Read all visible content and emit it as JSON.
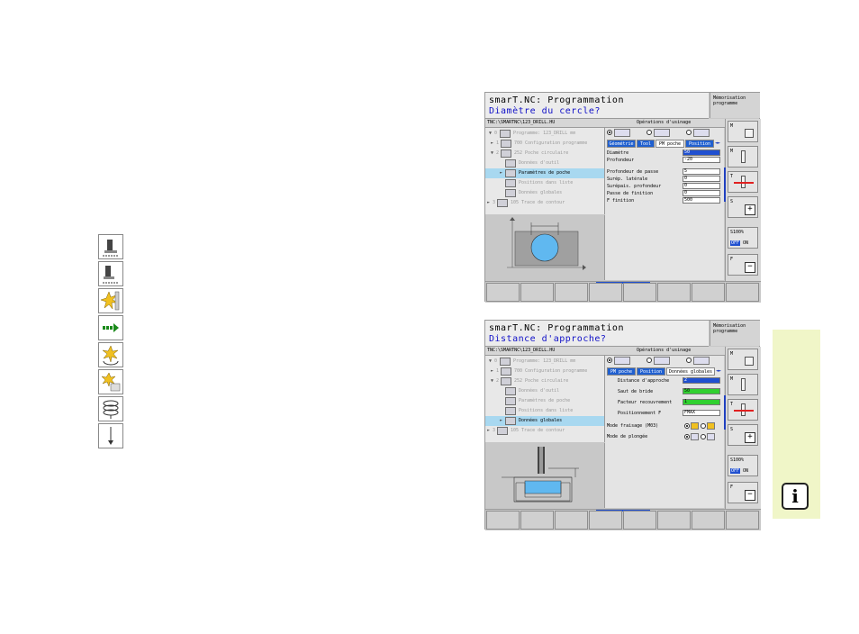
{
  "left_icons": [
    "tool-holder-icon",
    "tool-holder-alt-icon",
    "milling-star-icon",
    "arrow-right-icon",
    "rotate-star-icon",
    "star-corner-icon",
    "helix-icon",
    "arrow-down-icon"
  ],
  "screen1": {
    "title": "smarT.NC: Programmation",
    "question": "Diamètre du cercle?",
    "memo": "Mémorisation programme",
    "path": "TNC:\\SMARTNC\\123_DRILL.HU",
    "operations": "Opérations d'usinage",
    "tree": [
      {
        "num": "0",
        "label": "Programme: 123_DRILL mm",
        "level": 0,
        "dim": true
      },
      {
        "num": "1",
        "label": "700 Configuration programme",
        "level": 1,
        "dim": true
      },
      {
        "num": "2",
        "label": "252 Poche circulaire",
        "level": 1,
        "dim": true
      },
      {
        "num": "",
        "label": "Données d'outil",
        "level": 2,
        "dim": true
      },
      {
        "num": "",
        "label": "Paramètres de poche",
        "level": 2,
        "dim": false,
        "selected": true
      },
      {
        "num": "",
        "label": "Positions dans liste",
        "level": 2,
        "dim": true
      },
      {
        "num": "",
        "label": "Données globales",
        "level": 2,
        "dim": true
      },
      {
        "num": "3",
        "label": "105 Trace de contour",
        "level": 1,
        "dim": true
      }
    ],
    "tabs": [
      "Géométrie",
      "Tool",
      "PM poche",
      "Position"
    ],
    "tab_arrow": "◄►",
    "fields": [
      {
        "label": "Diamètre",
        "value": "50",
        "style": "hl"
      },
      {
        "label": "Profondeur",
        "value": "-20",
        "style": ""
      },
      {
        "label": "",
        "value": "",
        "style": "gap"
      },
      {
        "label": "Profondeur de passe",
        "value": "5",
        "style": ""
      },
      {
        "label": "Surép. latérale",
        "value": "0",
        "style": ""
      },
      {
        "label": "Surépais. profondeur",
        "value": "0",
        "style": ""
      },
      {
        "label": "Passe de finition",
        "value": "0",
        "style": ""
      },
      {
        "label": "F finition",
        "value": "500",
        "style": ""
      }
    ],
    "side_labels": {
      "m1": "M",
      "m2": "M",
      "m3": "T",
      "s1": "S",
      "s100": "S100%",
      "off": "OFF",
      "on": "ON",
      "f": "F"
    }
  },
  "screen2": {
    "title": "smarT.NC: Programmation",
    "question": "Distance d'approche?",
    "memo": "Mémorisation programme",
    "path": "TNC:\\SMARTNC\\123_DRILL.HU",
    "operations": "Opérations d'usinage",
    "tree": [
      {
        "num": "0",
        "label": "Programme: 123_DRILL mm",
        "level": 0,
        "dim": true
      },
      {
        "num": "1",
        "label": "700 Configuration programme",
        "level": 1,
        "dim": true
      },
      {
        "num": "2",
        "label": "252 Poche circulaire",
        "level": 1,
        "dim": true
      },
      {
        "num": "",
        "label": "Données d'outil",
        "level": 2,
        "dim": true
      },
      {
        "num": "",
        "label": "Paramètres de poche",
        "level": 2,
        "dim": true
      },
      {
        "num": "",
        "label": "Positions dans liste",
        "level": 2,
        "dim": true
      },
      {
        "num": "",
        "label": "Données globales",
        "level": 2,
        "dim": false,
        "selected": true
      },
      {
        "num": "3",
        "label": "105 Trace de contour",
        "level": 1,
        "dim": true
      }
    ],
    "tabs": [
      "PM poche",
      "Position",
      "Données globales"
    ],
    "tab_arrow": "◄►",
    "fields": [
      {
        "label": "Distance d'approche",
        "value": "2",
        "style": "hl"
      },
      {
        "label": "Saut de bride",
        "value": "50",
        "style": "gr"
      },
      {
        "label": "Facteur recouvrement",
        "value": "1",
        "style": "gr"
      },
      {
        "label": "Positionnement F",
        "value": "FMAX",
        "style": ""
      },
      {
        "label": "Mode fraisage (M03)",
        "value": "",
        "style": "radio"
      },
      {
        "label": "Mode de plongée",
        "value": "",
        "style": "radio"
      }
    ],
    "side_labels": {
      "m1": "M",
      "m2": "M",
      "m3": "T",
      "s1": "S",
      "s100": "S100%",
      "off": "OFF",
      "on": "ON",
      "f": "F"
    }
  },
  "info_icon": "i"
}
